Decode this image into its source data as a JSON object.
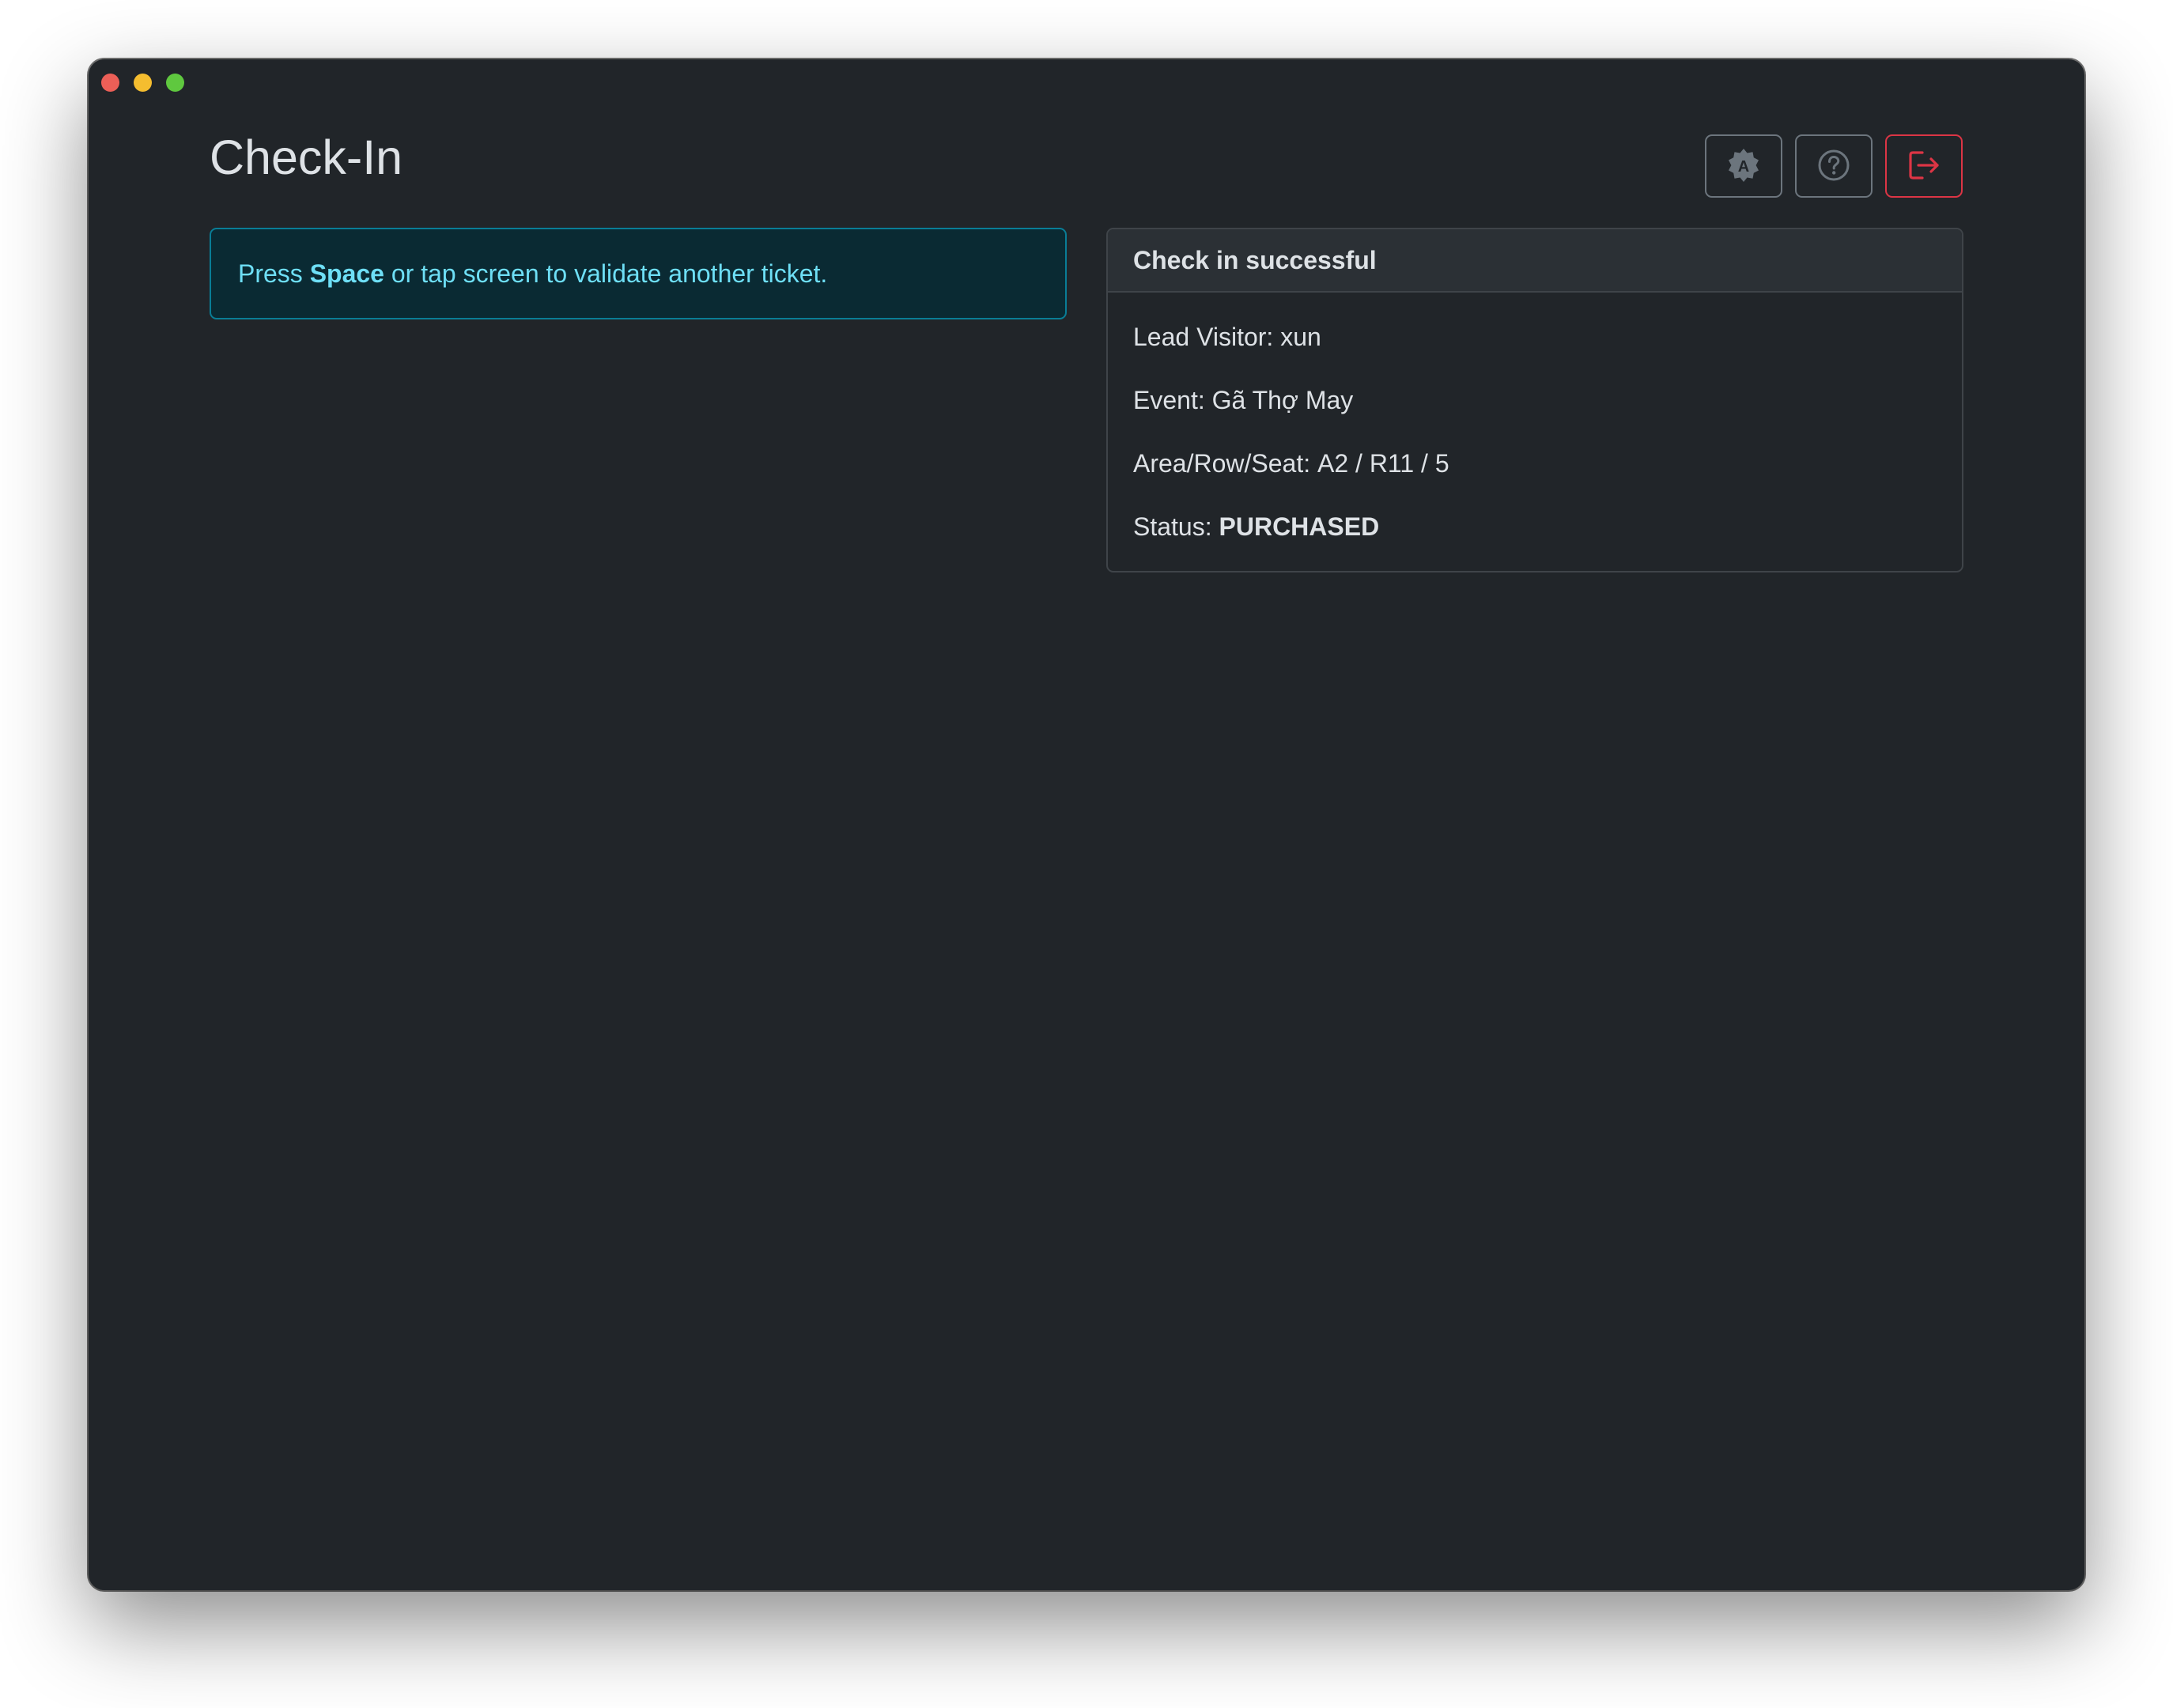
{
  "window": {
    "title": "Check-In"
  },
  "toolbar": {
    "theme_icon": "auto-theme-icon",
    "help_icon": "question-circle-icon",
    "logout_icon": "logout-icon"
  },
  "alert": {
    "prefix": "Press ",
    "key": "Space",
    "suffix": " or tap screen to validate another ticket."
  },
  "result": {
    "header": "Check in successful",
    "lead_visitor_label": "Lead Visitor:",
    "lead_visitor_value": "xun",
    "event_label": "Event:",
    "event_value": "Gã Thợ May",
    "seat_label": "Area/Row/Seat:",
    "seat_value": "A2 / R11 / 5",
    "status_label": "Status:",
    "status_value": "PURCHASED"
  },
  "colors": {
    "background": "#212529",
    "alert_text": "#6edff6",
    "danger": "#dc3545"
  }
}
